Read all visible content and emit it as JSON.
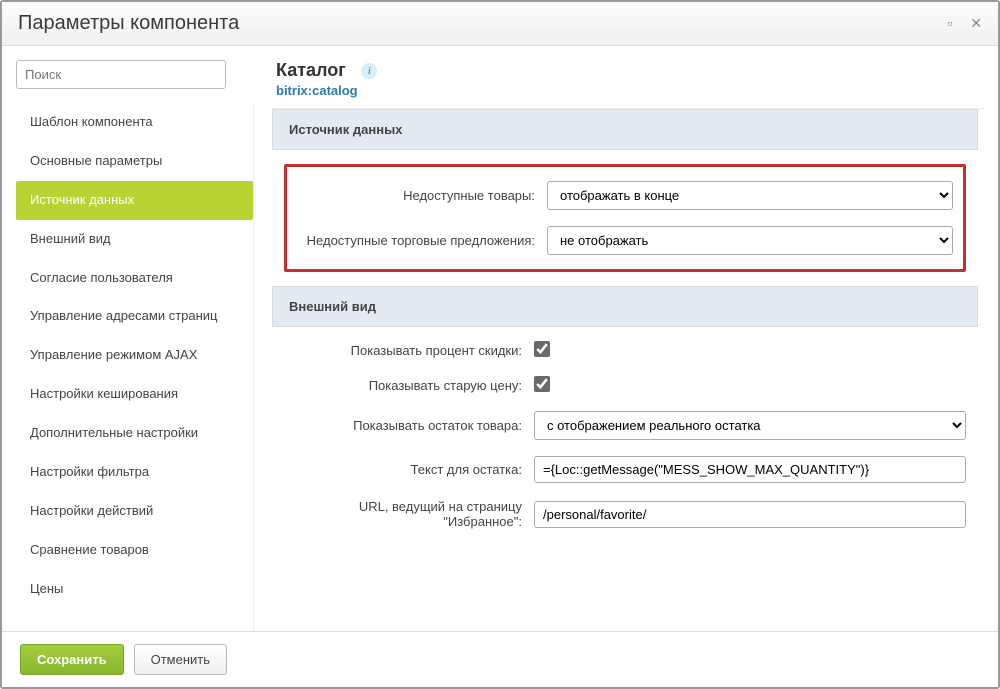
{
  "dialog": {
    "title": "Параметры компонента"
  },
  "search": {
    "placeholder": "Поиск"
  },
  "sidebar": {
    "items": [
      {
        "label": "Шаблон компонента",
        "active": false
      },
      {
        "label": "Основные параметры",
        "active": false
      },
      {
        "label": "Источник данных",
        "active": true
      },
      {
        "label": "Внешний вид",
        "active": false
      },
      {
        "label": "Согласие пользователя",
        "active": false
      },
      {
        "label": "Управление адресами страниц",
        "active": false
      },
      {
        "label": "Управление режимом AJAX",
        "active": false
      },
      {
        "label": "Настройки кеширования",
        "active": false
      },
      {
        "label": "Дополнительные настройки",
        "active": false
      },
      {
        "label": "Настройки фильтра",
        "active": false
      },
      {
        "label": "Настройки действий",
        "active": false
      },
      {
        "label": "Сравнение товаров",
        "active": false
      },
      {
        "label": "Цены",
        "active": false
      }
    ]
  },
  "header": {
    "title": "Каталог",
    "component": "bitrix:catalog"
  },
  "sections": {
    "data_source": {
      "title": "Источник данных",
      "fields": {
        "unavailable_products": {
          "label": "Недоступные товары:",
          "value": "отображать в конце"
        },
        "unavailable_offers": {
          "label": "Недоступные торговые предложения:",
          "value": "не отображать"
        }
      }
    },
    "appearance": {
      "title": "Внешний вид",
      "fields": {
        "show_discount_percent": {
          "label": "Показывать процент скидки:",
          "checked": true
        },
        "show_old_price": {
          "label": "Показывать старую цену:",
          "checked": true
        },
        "show_stock": {
          "label": "Показывать остаток товара:",
          "value": "с отображением реального остатка"
        },
        "stock_text": {
          "label": "Текст для остатка:",
          "value": "={Loc::getMessage(\"MESS_SHOW_MAX_QUANTITY\")}"
        },
        "favorite_url": {
          "label": "URL, ведущий на страницу \"Избранное\":",
          "value": "/personal/favorite/"
        }
      }
    }
  },
  "buttons": {
    "save": "Сохранить",
    "cancel": "Отменить"
  }
}
